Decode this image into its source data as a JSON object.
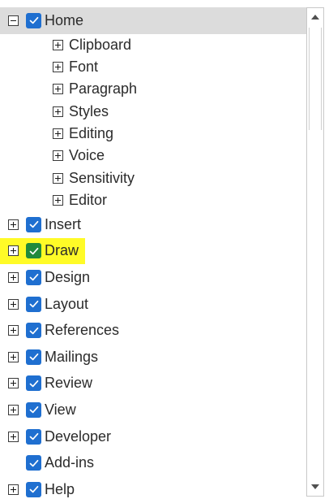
{
  "colors": {
    "checkbox_blue": "#1f6fd0",
    "checkbox_green": "#1f8a3c",
    "highlight_yellow": "#fffb27",
    "selected_row": "#dcdcdc"
  },
  "tree": {
    "home": {
      "label": "Home",
      "expander": "minus",
      "checked": true,
      "selected": true,
      "children": [
        {
          "label": "Clipboard"
        },
        {
          "label": "Font"
        },
        {
          "label": "Paragraph"
        },
        {
          "label": "Styles"
        },
        {
          "label": "Editing"
        },
        {
          "label": "Voice"
        },
        {
          "label": "Sensitivity"
        },
        {
          "label": "Editor"
        }
      ]
    },
    "items": [
      {
        "label": "Insert",
        "expander": "plus",
        "checked": true
      },
      {
        "label": "Draw",
        "expander": "plus",
        "checked": true,
        "highlighted": true
      },
      {
        "label": "Design",
        "expander": "plus",
        "checked": true
      },
      {
        "label": "Layout",
        "expander": "plus",
        "checked": true
      },
      {
        "label": "References",
        "expander": "plus",
        "checked": true
      },
      {
        "label": "Mailings",
        "expander": "plus",
        "checked": true
      },
      {
        "label": "Review",
        "expander": "plus",
        "checked": true
      },
      {
        "label": "View",
        "expander": "plus",
        "checked": true
      },
      {
        "label": "Developer",
        "expander": "plus",
        "checked": true
      },
      {
        "label": "Add-ins",
        "expander": "none",
        "checked": true
      },
      {
        "label": "Help",
        "expander": "plus",
        "checked": true
      }
    ]
  },
  "scrollbar": {
    "up_icon": "arrow-up-icon",
    "down_icon": "arrow-down-icon",
    "position": 0
  }
}
